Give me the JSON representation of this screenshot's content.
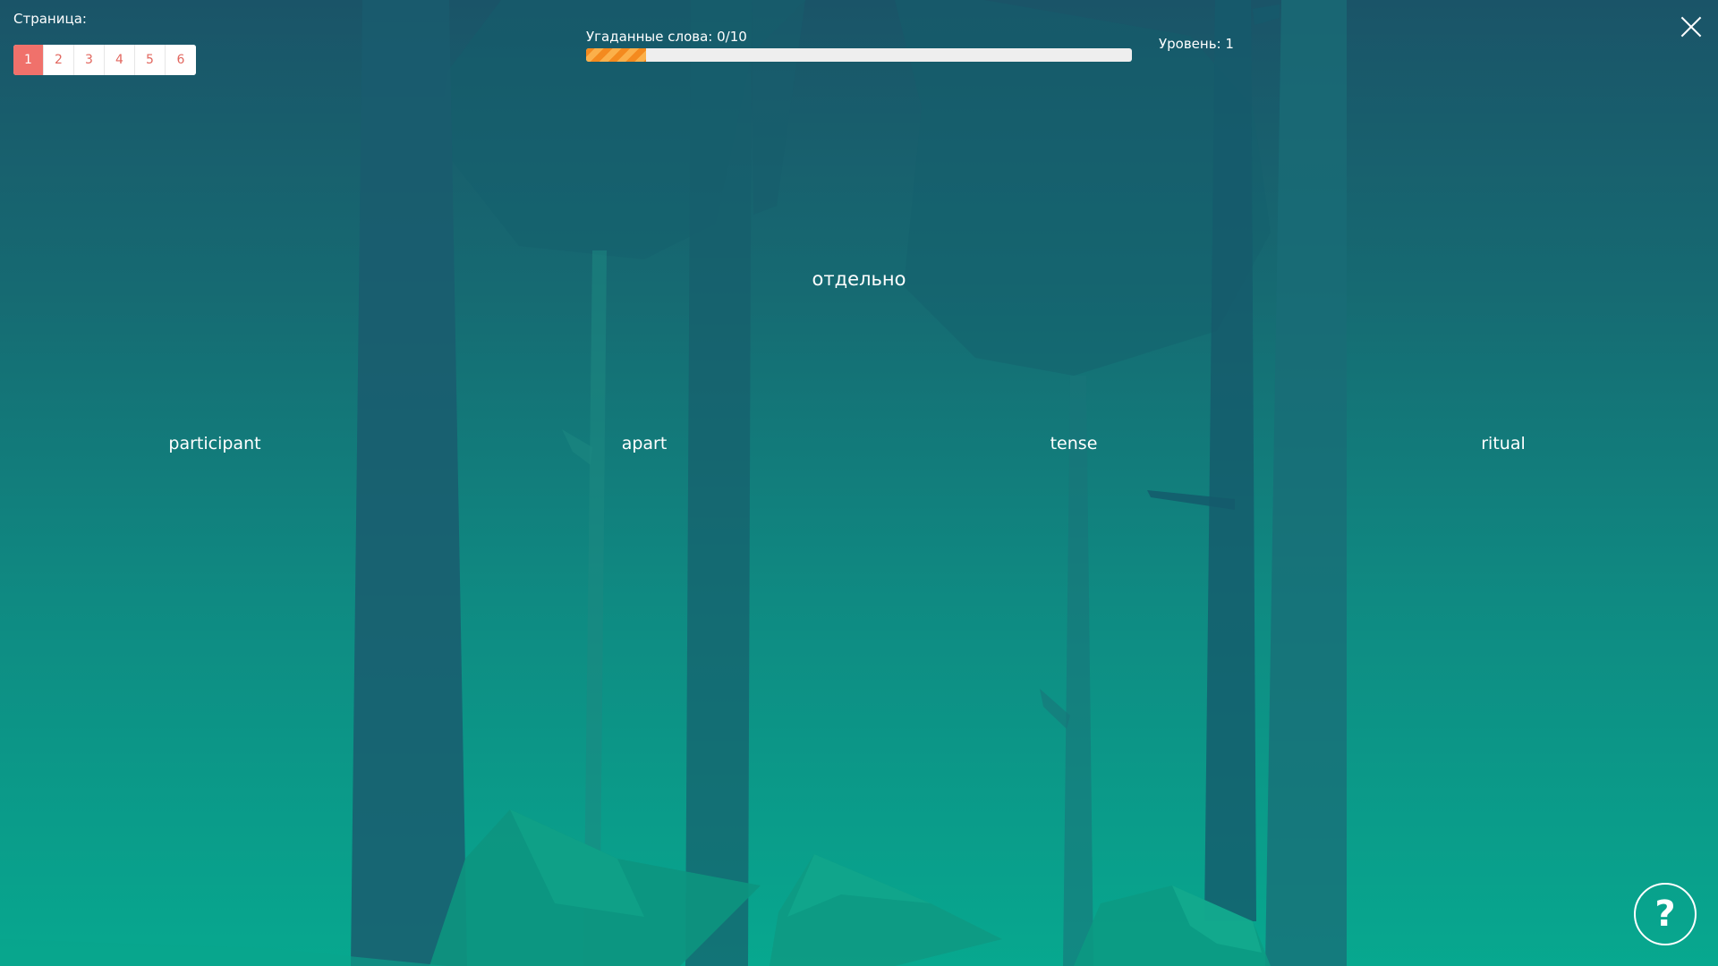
{
  "pager": {
    "title": "Страница:",
    "pages": [
      "1",
      "2",
      "3",
      "4",
      "5",
      "6"
    ],
    "active_page": "1"
  },
  "progress": {
    "label": "Угаданные слова: 0/10",
    "fill_fraction": 0.11
  },
  "level": {
    "label": "Уровень: 1"
  },
  "game": {
    "target_word": "отдельно",
    "options": [
      "participant",
      "apart",
      "tense",
      "ritual"
    ]
  },
  "help": {
    "glyph": "?"
  },
  "icons": {
    "close": "close-icon",
    "help": "question-mark-icon"
  },
  "colors": {
    "active_page": "#f0716b",
    "page_text": "#e2675f",
    "progress_stripe_a": "#f48a1e",
    "progress_stripe_b": "#fbb04a",
    "background_top": "#1a5468",
    "background_bottom": "#07a88f"
  }
}
